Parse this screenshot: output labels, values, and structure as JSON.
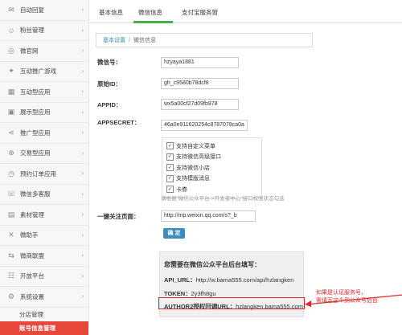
{
  "sidebar": {
    "items": [
      {
        "label": "自动回复",
        "icon": "message-icon",
        "glyph": "✉"
      },
      {
        "label": "粉丝管理",
        "icon": "users-icon",
        "glyph": "☺"
      },
      {
        "label": "微官网",
        "icon": "globe-icon",
        "glyph": "◎"
      },
      {
        "label": "互动推广游戏",
        "icon": "gamepad-icon",
        "glyph": "✦"
      },
      {
        "label": "互动型应用",
        "icon": "grid-icon",
        "glyph": "▦"
      },
      {
        "label": "展示型应用",
        "icon": "display-icon",
        "glyph": "▣"
      },
      {
        "label": "推广型应用",
        "icon": "share-icon",
        "glyph": "⋖"
      },
      {
        "label": "交易型应用",
        "icon": "cart-icon",
        "glyph": "⊕"
      },
      {
        "label": "预约订单应用",
        "icon": "clock-icon",
        "glyph": "◷"
      },
      {
        "label": "微信多客服",
        "icon": "chat-icon",
        "glyph": "☏"
      },
      {
        "label": "素材管理",
        "icon": "folder-icon",
        "glyph": "▤"
      },
      {
        "label": "微助手",
        "icon": "tools-icon",
        "glyph": "✕"
      },
      {
        "label": "微商联盟",
        "icon": "link-icon",
        "glyph": "⇆"
      },
      {
        "label": "开放平台",
        "icon": "open-icon",
        "glyph": "☷"
      },
      {
        "label": "系统设置",
        "icon": "gear-icon",
        "glyph": "⚙"
      }
    ],
    "sub_items": [
      {
        "label": "分店管理",
        "active": false
      },
      {
        "label": "账号信息管理",
        "active": true
      }
    ]
  },
  "tabs": [
    {
      "label": "基本信息"
    },
    {
      "label": "微信信息"
    },
    {
      "label": "支付宝服务窗"
    }
  ],
  "breadcrumb": {
    "link": "基本设置",
    "separator": "/",
    "current": "微信信息"
  },
  "form": {
    "wechat_id_label": "微信号：",
    "wechat_id_value": "hzyaya1881",
    "original_id_label": "原始ID：",
    "original_id_value": "gh_c9580b78dcf8",
    "appid_label": "APPID：",
    "appid_value": "wx5a00cf27d09fb978",
    "appsecret_label": "APPSECRET：",
    "appsecret_value": "46a0e911620254c8787078ca0a",
    "capabilities": [
      "支持自定义菜单",
      "支持微信高级接口",
      "支持微信小店",
      "支持模版消息",
      "卡券"
    ],
    "hint": "请根据\"微信公众平台->开发者中心\"接口权限状态勾选",
    "follow_page_label": "一键关注页面：",
    "follow_page_value": "http://mp.weixin.qq.com/s?_b",
    "confirm_label": "确 定"
  },
  "infobox": {
    "title": "您需要在微信公众平台后台填写：",
    "api_url_key": "API_URL：",
    "api_url_value": "http://w.bama555.com/api/hzlangken",
    "token_key": "TOKEN：",
    "token_value": "2y3fh8gu",
    "author_key": "AUTHOR2授权回调URL：",
    "author_value": "hzlangken.bama555.com"
  },
  "annotation": {
    "line1": "如果是认证服务号，",
    "line2": "需填写这个到公众号后台"
  },
  "colors": {
    "accent": "#44b549",
    "active_item": "#e8483c",
    "link": "#3c8dbc",
    "highlight": "#e0282c"
  }
}
